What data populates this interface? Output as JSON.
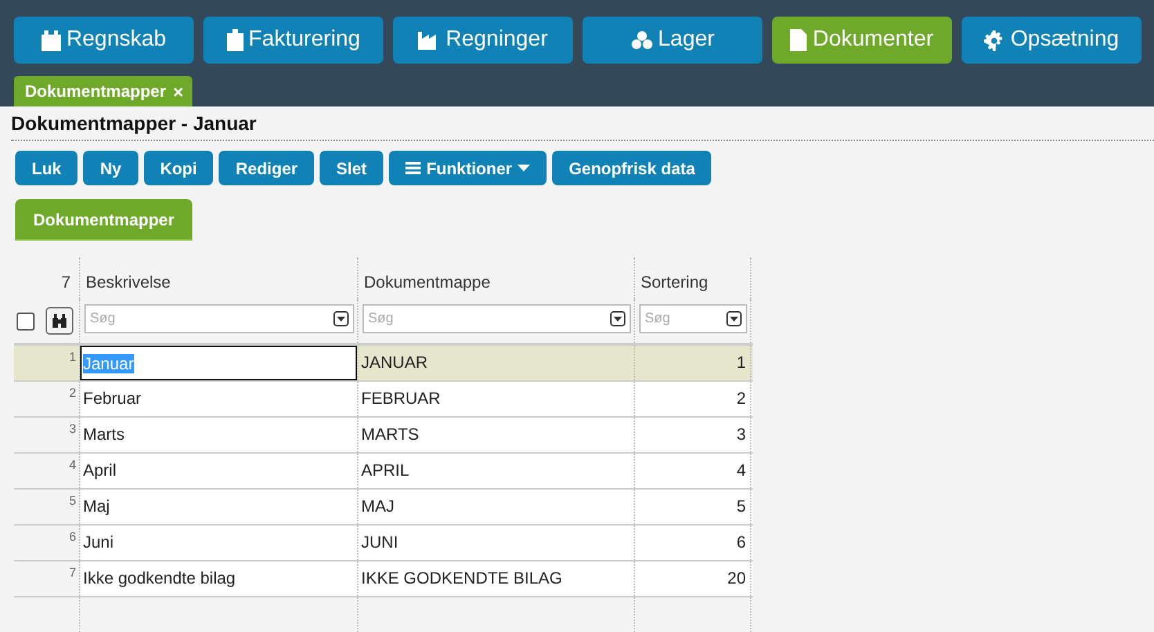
{
  "nav": [
    {
      "label": "Regnskab",
      "selected": false
    },
    {
      "label": "Fakturering",
      "selected": false
    },
    {
      "label": "Regninger",
      "selected": false
    },
    {
      "label": "Lager",
      "selected": false
    },
    {
      "label": "Dokumenter",
      "selected": true
    },
    {
      "label": "Opsætning",
      "selected": false
    }
  ],
  "open_tabs": [
    {
      "label": "Dokumentmapper",
      "close": "×",
      "selected": true
    }
  ],
  "page_title": "Dokumentmapper - Januar",
  "toolbar": [
    {
      "label": "Luk",
      "kind": "button"
    },
    {
      "label": "Ny",
      "kind": "button"
    },
    {
      "label": "Kopi",
      "kind": "button"
    },
    {
      "label": "Rediger",
      "kind": "button"
    },
    {
      "label": "Slet",
      "kind": "button"
    },
    {
      "label": "Funktioner",
      "kind": "menu"
    },
    {
      "label": "Genopfrisk data",
      "kind": "button"
    }
  ],
  "subtabs": [
    {
      "label": "Dokumentmapper",
      "selected": true
    }
  ],
  "table": {
    "count": "7",
    "select_all": {
      "checked": false
    },
    "columns": [
      {
        "header": "Beskrivelse",
        "filter_placeholder": "Søg",
        "kind": "text"
      },
      {
        "header": "Dokumentmappe",
        "filter_placeholder": "Søg",
        "kind": "text"
      },
      {
        "header": "Sortering",
        "filter_placeholder": "Søg",
        "kind": "number"
      }
    ],
    "rows": [
      {
        "number": "1",
        "cells": [
          "Januar",
          "JANUAR",
          "1"
        ],
        "selected": true
      },
      {
        "number": "2",
        "cells": [
          "Februar",
          "FEBRUAR",
          "2"
        ],
        "selected": false
      },
      {
        "number": "3",
        "cells": [
          "Marts",
          "MARTS",
          "3"
        ],
        "selected": false
      },
      {
        "number": "4",
        "cells": [
          "April",
          "APRIL",
          "4"
        ],
        "selected": false
      },
      {
        "number": "5",
        "cells": [
          "Maj",
          "MAJ",
          "5"
        ],
        "selected": false
      },
      {
        "number": "6",
        "cells": [
          "Juni",
          "JUNI",
          "6"
        ],
        "selected": false
      },
      {
        "number": "7",
        "cells": [
          "Ikke godkendte bilag",
          "IKKE GODKENDTE BILAG",
          "20"
        ],
        "selected": false
      }
    ]
  }
}
